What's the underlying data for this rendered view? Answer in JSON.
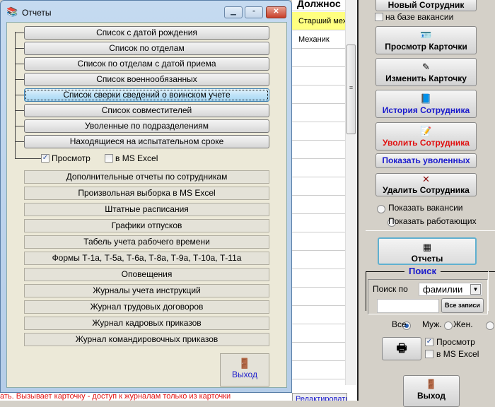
{
  "grid": {
    "header": "Должнос",
    "rows": [
      "Старший мех",
      "Механик",
      "",
      "",
      "",
      "",
      "",
      "",
      "",
      "",
      "",
      "",
      "",
      "",
      "",
      "",
      "",
      "",
      "",
      ""
    ]
  },
  "status_text": "ать. Вызывает карточку - доступ к журналам только из карточки",
  "edit_button": "Редактировать",
  "right": {
    "new_employee": "Новый Сотрудник",
    "vacancy_base": "на базе вакансии",
    "view_card": "Просмотр Карточки",
    "edit_card": "Изменить Карточку",
    "history": "История Сотрудника",
    "dismiss": "Уволить Сотрудника",
    "show_dismissed": "Показать уволенных",
    "delete": "Удалить Сотрудника",
    "show_vacancies": "Показать вакансии",
    "show_working": "Показать работающих",
    "reports": "Отчеты",
    "search_title": "Поиск",
    "search_by": "Поиск по",
    "search_field": "фамилии",
    "search_value": "",
    "all_records": "Все записи",
    "gender": [
      "Все",
      "Муж.",
      "Жен."
    ],
    "preview": "Просмотр",
    "excel": "в MS Excel",
    "exit": "Выход",
    "colors": {
      "blue": "#1a1acc",
      "red": "#e01010"
    }
  },
  "dialog": {
    "title": "Отчеты",
    "report_buttons": [
      "Список с датой рождения",
      "Список по отделам",
      "Список по отделам с датой приема",
      "Список военнообязанных",
      "Список сверки сведений о воинском учете",
      "Список совместителей",
      "Уволенные по подразделениям",
      "Находящиеся на испытательном сроке"
    ],
    "preview": "Просмотр",
    "excel": "в MS Excel",
    "other_buttons": [
      "Дополнительные отчеты по сотрудникам",
      "Произвольная выборка в MS Excel",
      "Штатные расписания",
      "Графики отпусков",
      "Табель учета рабочего времени",
      "Формы Т-1а, Т-5а, Т-6а, Т-8а, Т-9а, Т-10а, Т-11а",
      "Оповещения",
      "Журналы учета инструкций",
      "Журнал трудовых договоров",
      "Журнал кадровых приказов",
      "Журнал командировочных приказов"
    ],
    "exit": "Выход"
  }
}
